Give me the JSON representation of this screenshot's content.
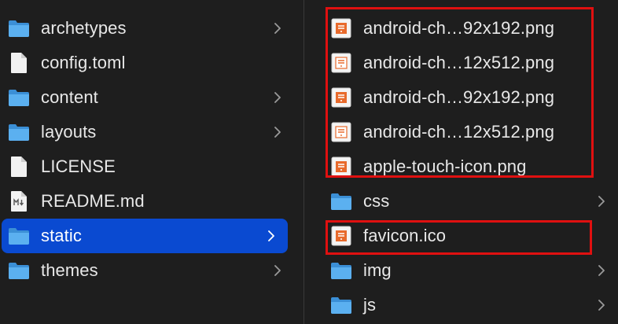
{
  "left_column": {
    "items": [
      {
        "name": "archetypes",
        "kind": "folder",
        "has_chevron": true
      },
      {
        "name": "config.toml",
        "kind": "file",
        "has_chevron": false
      },
      {
        "name": "content",
        "kind": "folder",
        "has_chevron": true
      },
      {
        "name": "layouts",
        "kind": "folder",
        "has_chevron": true
      },
      {
        "name": "LICENSE",
        "kind": "file",
        "has_chevron": false
      },
      {
        "name": "README.md",
        "kind": "markdown-file",
        "has_chevron": false
      },
      {
        "name": "static",
        "kind": "folder",
        "has_chevron": true,
        "selected": true
      },
      {
        "name": "themes",
        "kind": "folder",
        "has_chevron": true
      }
    ]
  },
  "right_column": {
    "items": [
      {
        "name": "android-ch…92x192.png",
        "kind": "image-file",
        "has_chevron": false
      },
      {
        "name": "android-ch…12x512.png",
        "kind": "image-file",
        "has_chevron": false
      },
      {
        "name": "android-ch…92x192.png",
        "kind": "image-file",
        "has_chevron": false
      },
      {
        "name": "android-ch…12x512.png",
        "kind": "image-file",
        "has_chevron": false
      },
      {
        "name": "apple-touch-icon.png",
        "kind": "image-file",
        "has_chevron": false
      },
      {
        "name": "css",
        "kind": "folder",
        "has_chevron": true
      },
      {
        "name": "favicon.ico",
        "kind": "image-file",
        "has_chevron": false
      },
      {
        "name": "img",
        "kind": "folder",
        "has_chevron": true
      },
      {
        "name": "js",
        "kind": "folder",
        "has_chevron": true
      }
    ]
  },
  "colors": {
    "background": "#1e1e1e",
    "selection": "#0a4ad1",
    "folder_icon": "#4aa3e8",
    "highlight_box": "#e01010",
    "image_icon_accent": "#e86a2c"
  }
}
